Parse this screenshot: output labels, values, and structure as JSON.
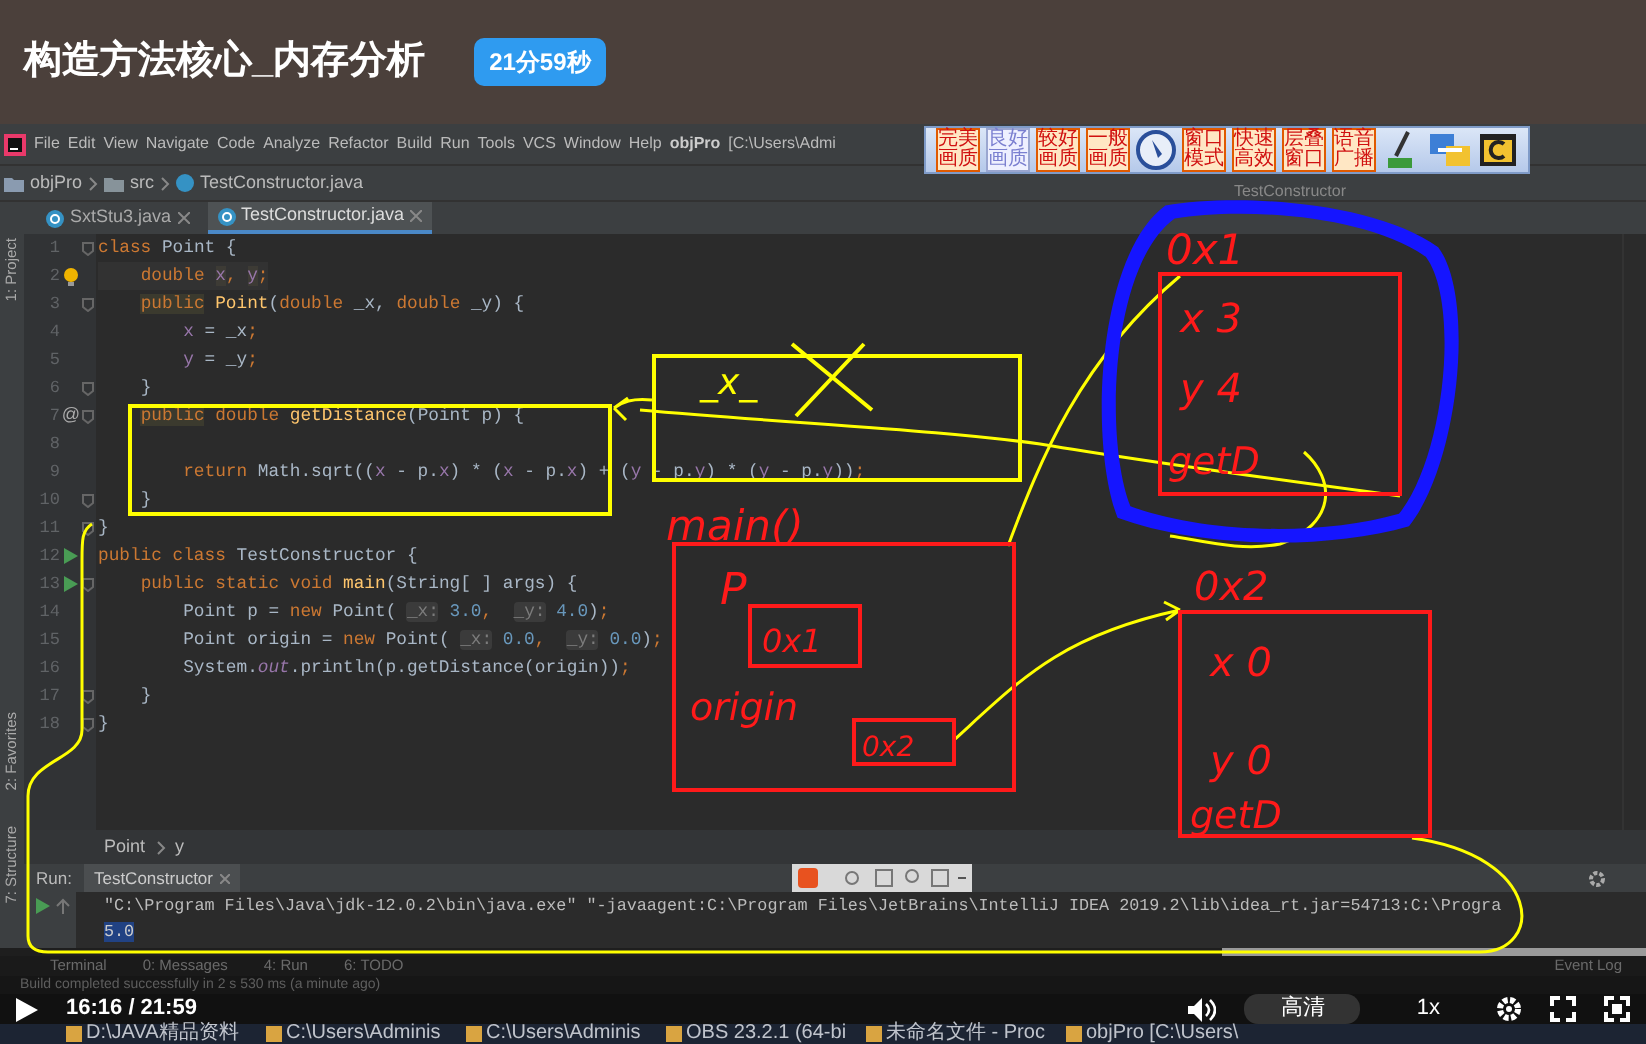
{
  "video_title": "构造方法核心_内存分析",
  "duration_badge": "21分59秒",
  "ide": {
    "menu": [
      "File",
      "Edit",
      "View",
      "Navigate",
      "Code",
      "Analyze",
      "Refactor",
      "Build",
      "Run",
      "Tools",
      "VCS",
      "Window",
      "Help"
    ],
    "project_title": "objPro",
    "project_path": "[C:\\Users\\Admi",
    "overlay_toolbar": [
      {
        "kind": "button",
        "text": "完美画质",
        "disabled": false
      },
      {
        "kind": "button",
        "text": "良好画质",
        "disabled": true
      },
      {
        "kind": "button",
        "text": "较好画质",
        "disabled": false
      },
      {
        "kind": "button",
        "text": "一般画质",
        "disabled": false
      },
      {
        "kind": "dial"
      },
      {
        "kind": "button",
        "text": "窗口模式",
        "disabled": false
      },
      {
        "kind": "button",
        "text": "快速高效",
        "disabled": false
      },
      {
        "kind": "button",
        "text": "层叠窗口",
        "disabled": false
      },
      {
        "kind": "button",
        "text": "语音广播",
        "disabled": false
      },
      {
        "kind": "brush"
      },
      {
        "kind": "display"
      },
      {
        "kind": "app"
      }
    ],
    "breadcrumb": [
      {
        "kind": "project",
        "text": "objPro"
      },
      {
        "kind": "folder",
        "text": "src"
      },
      {
        "kind": "class",
        "text": "TestConstructor.java"
      }
    ],
    "run_config": "TestConstructor",
    "tabs": [
      {
        "label": "SxtStu3.java",
        "selected": false
      },
      {
        "label": "TestConstructor.java",
        "selected": true
      }
    ],
    "side_tabs": [
      "1: Project",
      "2: Favorites",
      "7: Structure"
    ],
    "code_lines": [
      {
        "number": "1",
        "fold": true,
        "code": [
          {
            "text": "class",
            "kind": "keyword"
          },
          {
            "text": " Point {",
            "kind": "plain"
          }
        ]
      },
      {
        "number": "2",
        "current": true,
        "gutter_icon": {
          "kind": "bulb"
        },
        "code": [
          {
            "text": "    double",
            "kind": "keyword"
          },
          {
            "text": " x",
            "kind": "field_hl"
          },
          {
            "text": ", ",
            "kind": "keyword"
          },
          {
            "text": "y",
            "kind": "field_hl"
          },
          {
            "text": ";",
            "kind": "keyword"
          }
        ]
      },
      {
        "number": "3",
        "fold": true,
        "code": [
          {
            "text": "    public",
            "kind": "keyword_hl"
          },
          {
            "text": " Point",
            "kind": "function"
          },
          {
            "text": "(",
            "kind": "plain"
          },
          {
            "text": "double",
            "kind": "keyword"
          },
          {
            "text": " _x, ",
            "kind": "plain"
          },
          {
            "text": "double",
            "kind": "keyword"
          },
          {
            "text": " _y) {",
            "kind": "plain"
          }
        ]
      },
      {
        "number": "4",
        "code": [
          {
            "text": "        x",
            "kind": "field"
          },
          {
            "text": " = _x",
            "kind": "plain"
          },
          {
            "text": ";",
            "kind": "keyword"
          }
        ]
      },
      {
        "number": "5",
        "code": [
          {
            "text": "        y",
            "kind": "field"
          },
          {
            "text": " = _y",
            "kind": "plain"
          },
          {
            "text": ";",
            "kind": "keyword"
          }
        ]
      },
      {
        "number": "6",
        "fold": true,
        "code": [
          {
            "text": "    }",
            "kind": "plain"
          }
        ]
      },
      {
        "number": "7",
        "fold": true,
        "marker": "@",
        "code": [
          {
            "text": "    public",
            "kind": "keyword_hl"
          },
          {
            "text": " double",
            "kind": "keyword"
          },
          {
            "text": " getDistance",
            "kind": "function"
          },
          {
            "text": "(Point p) {",
            "kind": "plain"
          }
        ]
      },
      {
        "number": "8"
      },
      {
        "number": "9",
        "code": [
          {
            "text": "        return",
            "kind": "keyword"
          },
          {
            "text": " Math.sqrt((",
            "kind": "plain"
          },
          {
            "text": "x",
            "kind": "field"
          },
          {
            "text": " - p.",
            "kind": "plain"
          },
          {
            "text": "x",
            "kind": "field"
          },
          {
            "text": ") * (",
            "kind": "plain"
          },
          {
            "text": "x",
            "kind": "field"
          },
          {
            "text": " - p.",
            "kind": "plain"
          },
          {
            "text": "x",
            "kind": "field"
          },
          {
            "text": ") + (",
            "kind": "plain"
          },
          {
            "text": "y",
            "kind": "field"
          },
          {
            "text": " - p.",
            "kind": "plain"
          },
          {
            "text": "y",
            "kind": "field"
          },
          {
            "text": ") * (",
            "kind": "plain"
          },
          {
            "text": "y",
            "kind": "field"
          },
          {
            "text": " - p.",
            "kind": "plain"
          },
          {
            "text": "y",
            "kind": "field"
          },
          {
            "text": "))",
            "kind": "plain"
          },
          {
            "text": ";",
            "kind": "keyword"
          }
        ]
      },
      {
        "number": "10",
        "fold": true,
        "code": [
          {
            "text": "    }",
            "kind": "plain"
          }
        ]
      },
      {
        "number": "11",
        "fold": true,
        "code": [
          {
            "text": "}",
            "kind": "plain"
          }
        ]
      },
      {
        "number": "12",
        "gutter_icon": {
          "kind": "run"
        },
        "code": [
          {
            "text": "public class",
            "kind": "keyword"
          },
          {
            "text": " TestConstructor {",
            "kind": "plain"
          }
        ]
      },
      {
        "number": "13",
        "fold": true,
        "gutter_icon": {
          "kind": "run"
        },
        "code": [
          {
            "text": "    public static void",
            "kind": "keyword"
          },
          {
            "text": " main",
            "kind": "function"
          },
          {
            "text": "(String[ ] args) {",
            "kind": "plain"
          }
        ]
      },
      {
        "number": "14",
        "code": [
          {
            "text": "        Point p = ",
            "kind": "plain"
          },
          {
            "text": "new",
            "kind": "keyword"
          },
          {
            "text": " Point( ",
            "kind": "plain"
          },
          {
            "text": "_x:",
            "kind": "hint"
          },
          {
            "text": " 3.0",
            "kind": "number"
          },
          {
            "text": ",  ",
            "kind": "keyword"
          },
          {
            "text": "_y:",
            "kind": "hint"
          },
          {
            "text": " 4.0",
            "kind": "number"
          },
          {
            "text": ")",
            "kind": "plain"
          },
          {
            "text": ";",
            "kind": "keyword"
          }
        ]
      },
      {
        "number": "15",
        "code": [
          {
            "text": "        Point origin = ",
            "kind": "plain"
          },
          {
            "text": "new",
            "kind": "keyword"
          },
          {
            "text": " Point( ",
            "kind": "plain"
          },
          {
            "text": "_x:",
            "kind": "hint"
          },
          {
            "text": " 0.0",
            "kind": "number"
          },
          {
            "text": ",  ",
            "kind": "keyword"
          },
          {
            "text": "_y:",
            "kind": "hint"
          },
          {
            "text": " 0.0",
            "kind": "number"
          },
          {
            "text": ")",
            "kind": "plain"
          },
          {
            "text": ";",
            "kind": "keyword"
          }
        ]
      },
      {
        "number": "16",
        "code": [
          {
            "text": "        System.",
            "kind": "plain"
          },
          {
            "text": "out",
            "kind": "static"
          },
          {
            "text": ".println(p.getDistance(origin))",
            "kind": "plain"
          },
          {
            "text": ";",
            "kind": "keyword"
          }
        ]
      },
      {
        "number": "17",
        "fold": true,
        "code": [
          {
            "text": "    }",
            "kind": "plain"
          }
        ]
      },
      {
        "number": "18",
        "fold": true,
        "code": [
          {
            "text": "}",
            "kind": "plain"
          }
        ]
      }
    ],
    "editor_breadcrumb": [
      "Point",
      "y"
    ],
    "run_panel": {
      "label": "Run:",
      "tab": "TestConstructor",
      "output": [
        {
          "text": "\"C:\\Program Files\\Java\\jdk-12.0.2\\bin\\java.exe\" \"-javaagent:C:\\Program Files\\JetBrains\\IntelliJ IDEA 2019.2\\lib\\idea_rt.jar=54713:C:\\Progra",
          "selected": false
        },
        {
          "text": "5.0",
          "selected": true
        }
      ]
    },
    "bottom_tabs": [
      "Terminal",
      "0: Messages",
      "4: Run",
      "6: TODO"
    ],
    "event_log": "Event Log",
    "status": "Build completed successfully in 2 s 530 ms (a minute ago)"
  },
  "annotations": [
    {
      "text": "_x_",
      "color": "#ffff00"
    },
    {
      "text": "0x1",
      "color": "#ff1a1a"
    },
    {
      "text": "x 3",
      "color": "#ff1a1a"
    },
    {
      "text": "y 4",
      "color": "#ff1a1a"
    },
    {
      "text": "getD",
      "color": "#ff1a1a"
    },
    {
      "text": "main()",
      "color": "#ff1a1a"
    },
    {
      "text": "P",
      "color": "#ff1a1a"
    },
    {
      "text": "0x1",
      "color": "#ff1a1a"
    },
    {
      "text": "origin",
      "color": "#ff1a1a"
    },
    {
      "text": "0x2",
      "color": "#ff1a1a"
    },
    {
      "text": "0x2",
      "color": "#ff1a1a"
    },
    {
      "text": "x 0",
      "color": "#ff1a1a"
    },
    {
      "text": "y 0",
      "color": "#ff1a1a"
    },
    {
      "text": "getD",
      "color": "#ff1a1a"
    }
  ],
  "player": {
    "time": "16:16 / 21:59",
    "quality": "高清",
    "speed": "1x",
    "progress": {
      "level": 0.742
    }
  },
  "taskbar": [
    "D:\\JAVA精品资料",
    "C:\\Users\\Adminis",
    "C:\\Users\\Adminis",
    "OBS 23.2.1 (64-bi",
    "未命名文件 - Proc",
    "objPro [C:\\Users\\"
  ]
}
